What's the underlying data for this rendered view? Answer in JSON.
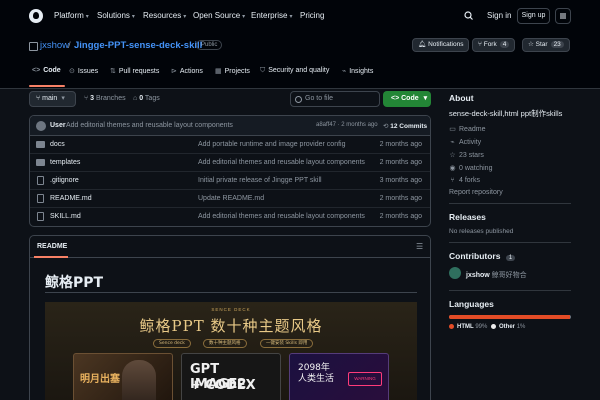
{
  "nav": {
    "items": [
      "Platform",
      "Solutions",
      "Resources",
      "Open Source",
      "Enterprise",
      "Pricing"
    ],
    "sign_in": "Sign in",
    "sign_up": "Sign up"
  },
  "repo": {
    "owner": "jxshow",
    "separator": "/",
    "name": "Jingge-PPT-sense-deck-skill",
    "visibility": "Public",
    "notifications_label": "Notifications",
    "fork_label": "Fork",
    "fork_count": "4",
    "star_label": "Star",
    "star_count": "23"
  },
  "tabs": [
    "Code",
    "Issues",
    "Pull requests",
    "Actions",
    "Projects",
    "Security and quality",
    "Insights"
  ],
  "branch": {
    "name": "main",
    "branches_count": "3",
    "branches_label": "Branches",
    "tags_count": "0",
    "tags_label": "Tags",
    "goto_placeholder": "Go to file",
    "code_button": "Code"
  },
  "latest_commit": {
    "author": "User",
    "message": "Add editorial themes and reusable layout components",
    "hash_time": "a8aff47 · 2 months ago",
    "commits_label": "12 Commits"
  },
  "files": [
    {
      "name": "docs",
      "type": "folder",
      "message": "Add portable runtime and image provider config",
      "time": "2 months ago"
    },
    {
      "name": "templates",
      "type": "folder",
      "message": "Add editorial themes and reusable layout components",
      "time": "2 months ago"
    },
    {
      "name": ".gitignore",
      "type": "file",
      "message": "Initial private release of Jingge PPT skill",
      "time": "3 months ago"
    },
    {
      "name": "README.md",
      "type": "file",
      "message": "Update README.md",
      "time": "2 months ago"
    },
    {
      "name": "SKILL.md",
      "type": "file",
      "message": "Add editorial themes and reusable layout components",
      "time": "2 months ago"
    }
  ],
  "readme": {
    "tab_label": "README",
    "title": "鲸格PPT",
    "banner": {
      "subtitle": "SENCE DECK",
      "headline": "鲸格PPT  数十种主题风格",
      "chips": [
        "Sence deck",
        "数十种主题风格",
        "一键安装 Skills 即用"
      ],
      "card1_text": "明月出塞",
      "card2_line1": "GPT IMAGE2",
      "card2_line2": "+ CODEX",
      "card3_line1": "2098年",
      "card3_line2": "人类生活",
      "card3_warning": "WARNING"
    }
  },
  "sidebar": {
    "about_heading": "About",
    "description": "sense-deck-skill,html ppt制作skills",
    "readme_link": "Readme",
    "activity_link": "Activity",
    "stars": "23 stars",
    "watching": "0 watching",
    "forks": "4 forks",
    "report": "Report repository",
    "releases_heading": "Releases",
    "releases_text": "No releases published",
    "contributors_heading": "Contributors",
    "contributors_count": "1",
    "contributor_name": "jxshow",
    "contributor_alias": "鲸哥好物合",
    "languages_heading": "Languages",
    "languages": [
      {
        "name": "HTML",
        "percent": "99%",
        "value": 99,
        "color": "#e34c26"
      },
      {
        "name": "Other",
        "percent": "1%",
        "value": 1,
        "color": "#ededed"
      }
    ]
  }
}
